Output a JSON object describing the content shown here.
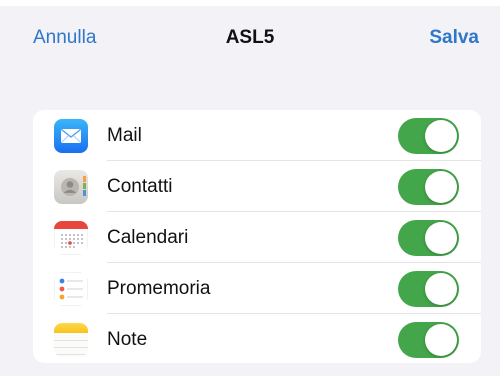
{
  "navbar": {
    "cancel_label": "Annulla",
    "title": "ASL5",
    "save_label": "Salva"
  },
  "accounts": {
    "items": [
      {
        "label": "Mail",
        "icon": "mail-icon",
        "enabled": true
      },
      {
        "label": "Contatti",
        "icon": "contacts-icon",
        "enabled": true
      },
      {
        "label": "Calendari",
        "icon": "calendar-icon",
        "enabled": true
      },
      {
        "label": "Promemoria",
        "icon": "reminders-icon",
        "enabled": true
      },
      {
        "label": "Note",
        "icon": "notes-icon",
        "enabled": true
      }
    ]
  },
  "colors": {
    "accent": "#2f77c9",
    "toggle_on": "#43a64a",
    "background": "#f2f2f7"
  }
}
